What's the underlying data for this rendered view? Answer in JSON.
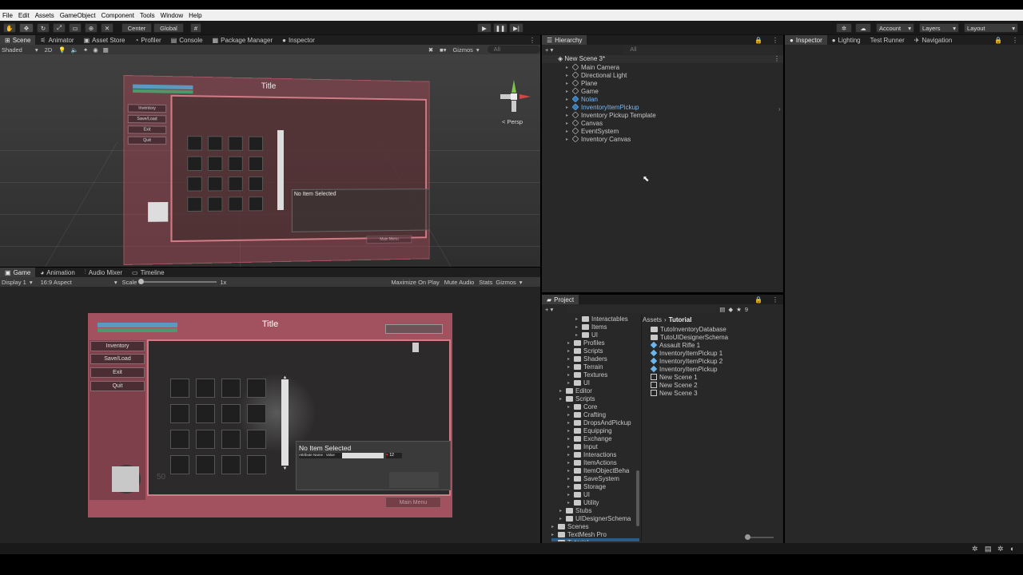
{
  "menu": [
    "File",
    "Edit",
    "Assets",
    "GameObject",
    "Component",
    "Tools",
    "Window",
    "Help"
  ],
  "toolbar": {
    "pivot_label": "Center",
    "space_label": "Global",
    "account_label": "Account",
    "layers_label": "Layers",
    "layout_label": "Layout"
  },
  "scene_panel": {
    "tabs": [
      "Scene",
      "Animator",
      "Asset Store",
      "Profiler",
      "Console",
      "Package Manager",
      "Inspector"
    ],
    "shading": "Shaded",
    "mode_2d": "2D",
    "gizmos": "Gizmos",
    "search_placeholder": "All",
    "persp_label": "< Persp",
    "ui_title": "Title",
    "side_buttons": [
      "Inventory",
      "Save/Load",
      "Exit",
      "Quit"
    ],
    "item_text": "No Item Selected",
    "main_menu": "Main Menu"
  },
  "game_panel": {
    "tabs": [
      "Game",
      "Animation",
      "Audio Mixer",
      "Timeline"
    ],
    "display": "Display 1",
    "aspect": "16:9 Aspect",
    "scale_label": "Scale",
    "scale_value": "1x",
    "maximize": "Maximize On Play",
    "mute": "Mute Audio",
    "stats": "Stats",
    "gizmos": "Gizmos",
    "ui_title": "Title",
    "side_buttons": [
      "Inventory",
      "Save/Load",
      "Exit",
      "Quit"
    ],
    "item_text": "No Item Selected",
    "attribute_text": "Attribute Name : Value",
    "attr_number": "12",
    "counter": "50",
    "main_menu": "Main Menu"
  },
  "hierarchy": {
    "tab": "Hierarchy",
    "search_placeholder": "All",
    "scene_name": "New Scene 3*",
    "items": [
      {
        "label": "Main Camera",
        "prefab": false
      },
      {
        "label": "Directional Light",
        "prefab": false
      },
      {
        "label": "Plane",
        "prefab": false
      },
      {
        "label": "Game",
        "prefab": false
      },
      {
        "label": "Nolan",
        "prefab": true
      },
      {
        "label": "InventoryItemPickup",
        "prefab": true
      },
      {
        "label": "Inventory Pickup Template",
        "prefab": false
      },
      {
        "label": "Canvas",
        "prefab": false
      },
      {
        "label": "EventSystem",
        "prefab": false
      },
      {
        "label": "Inventory Canvas",
        "prefab": false
      }
    ]
  },
  "inspector": {
    "tabs": [
      "Inspector",
      "Lighting",
      "Test Runner",
      "Navigation"
    ]
  },
  "project": {
    "tab": "Project",
    "breadcrumb_root": "Assets",
    "breadcrumb_current": "Tutorial",
    "folders": [
      {
        "label": "Interactables",
        "indent": 3
      },
      {
        "label": "Items",
        "indent": 3
      },
      {
        "label": "UI",
        "indent": 3
      },
      {
        "label": "Profiles",
        "indent": 2
      },
      {
        "label": "Scripts",
        "indent": 2
      },
      {
        "label": "Shaders",
        "indent": 2
      },
      {
        "label": "Terrain",
        "indent": 2
      },
      {
        "label": "Textures",
        "indent": 2
      },
      {
        "label": "UI",
        "indent": 2
      },
      {
        "label": "Editor",
        "indent": 1
      },
      {
        "label": "Scripts",
        "indent": 1
      },
      {
        "label": "Core",
        "indent": 2
      },
      {
        "label": "Crafting",
        "indent": 2
      },
      {
        "label": "DropsAndPickup",
        "indent": 2
      },
      {
        "label": "Equipping",
        "indent": 2
      },
      {
        "label": "Exchange",
        "indent": 2
      },
      {
        "label": "Input",
        "indent": 2
      },
      {
        "label": "Interactions",
        "indent": 2
      },
      {
        "label": "ItemActions",
        "indent": 2
      },
      {
        "label": "ItemObjectBeha",
        "indent": 2
      },
      {
        "label": "SaveSystem",
        "indent": 2
      },
      {
        "label": "Storage",
        "indent": 2
      },
      {
        "label": "UI",
        "indent": 2
      },
      {
        "label": "Utility",
        "indent": 2
      },
      {
        "label": "Stubs",
        "indent": 1
      },
      {
        "label": "UIDesignerSchema",
        "indent": 1
      },
      {
        "label": "Scenes",
        "indent": 0
      },
      {
        "label": "TextMesh Pro",
        "indent": 0
      },
      {
        "label": "Tutorial",
        "indent": 0
      }
    ],
    "assets": [
      {
        "label": "TutoInventoryDatabase",
        "kind": "folder"
      },
      {
        "label": "TutoUIDesignerSchema",
        "kind": "folder"
      },
      {
        "label": "Assault Rifle 1",
        "kind": "prefab"
      },
      {
        "label": "InventoryItemPickup 1",
        "kind": "prefab"
      },
      {
        "label": "InventoryItemPickup 2",
        "kind": "prefab"
      },
      {
        "label": "InventoryItemPickup",
        "kind": "prefab"
      },
      {
        "label": "New Scene 1",
        "kind": "scene"
      },
      {
        "label": "New Scene 2",
        "kind": "scene"
      },
      {
        "label": "New Scene 3",
        "kind": "scene"
      }
    ],
    "hidden_count": "9"
  }
}
